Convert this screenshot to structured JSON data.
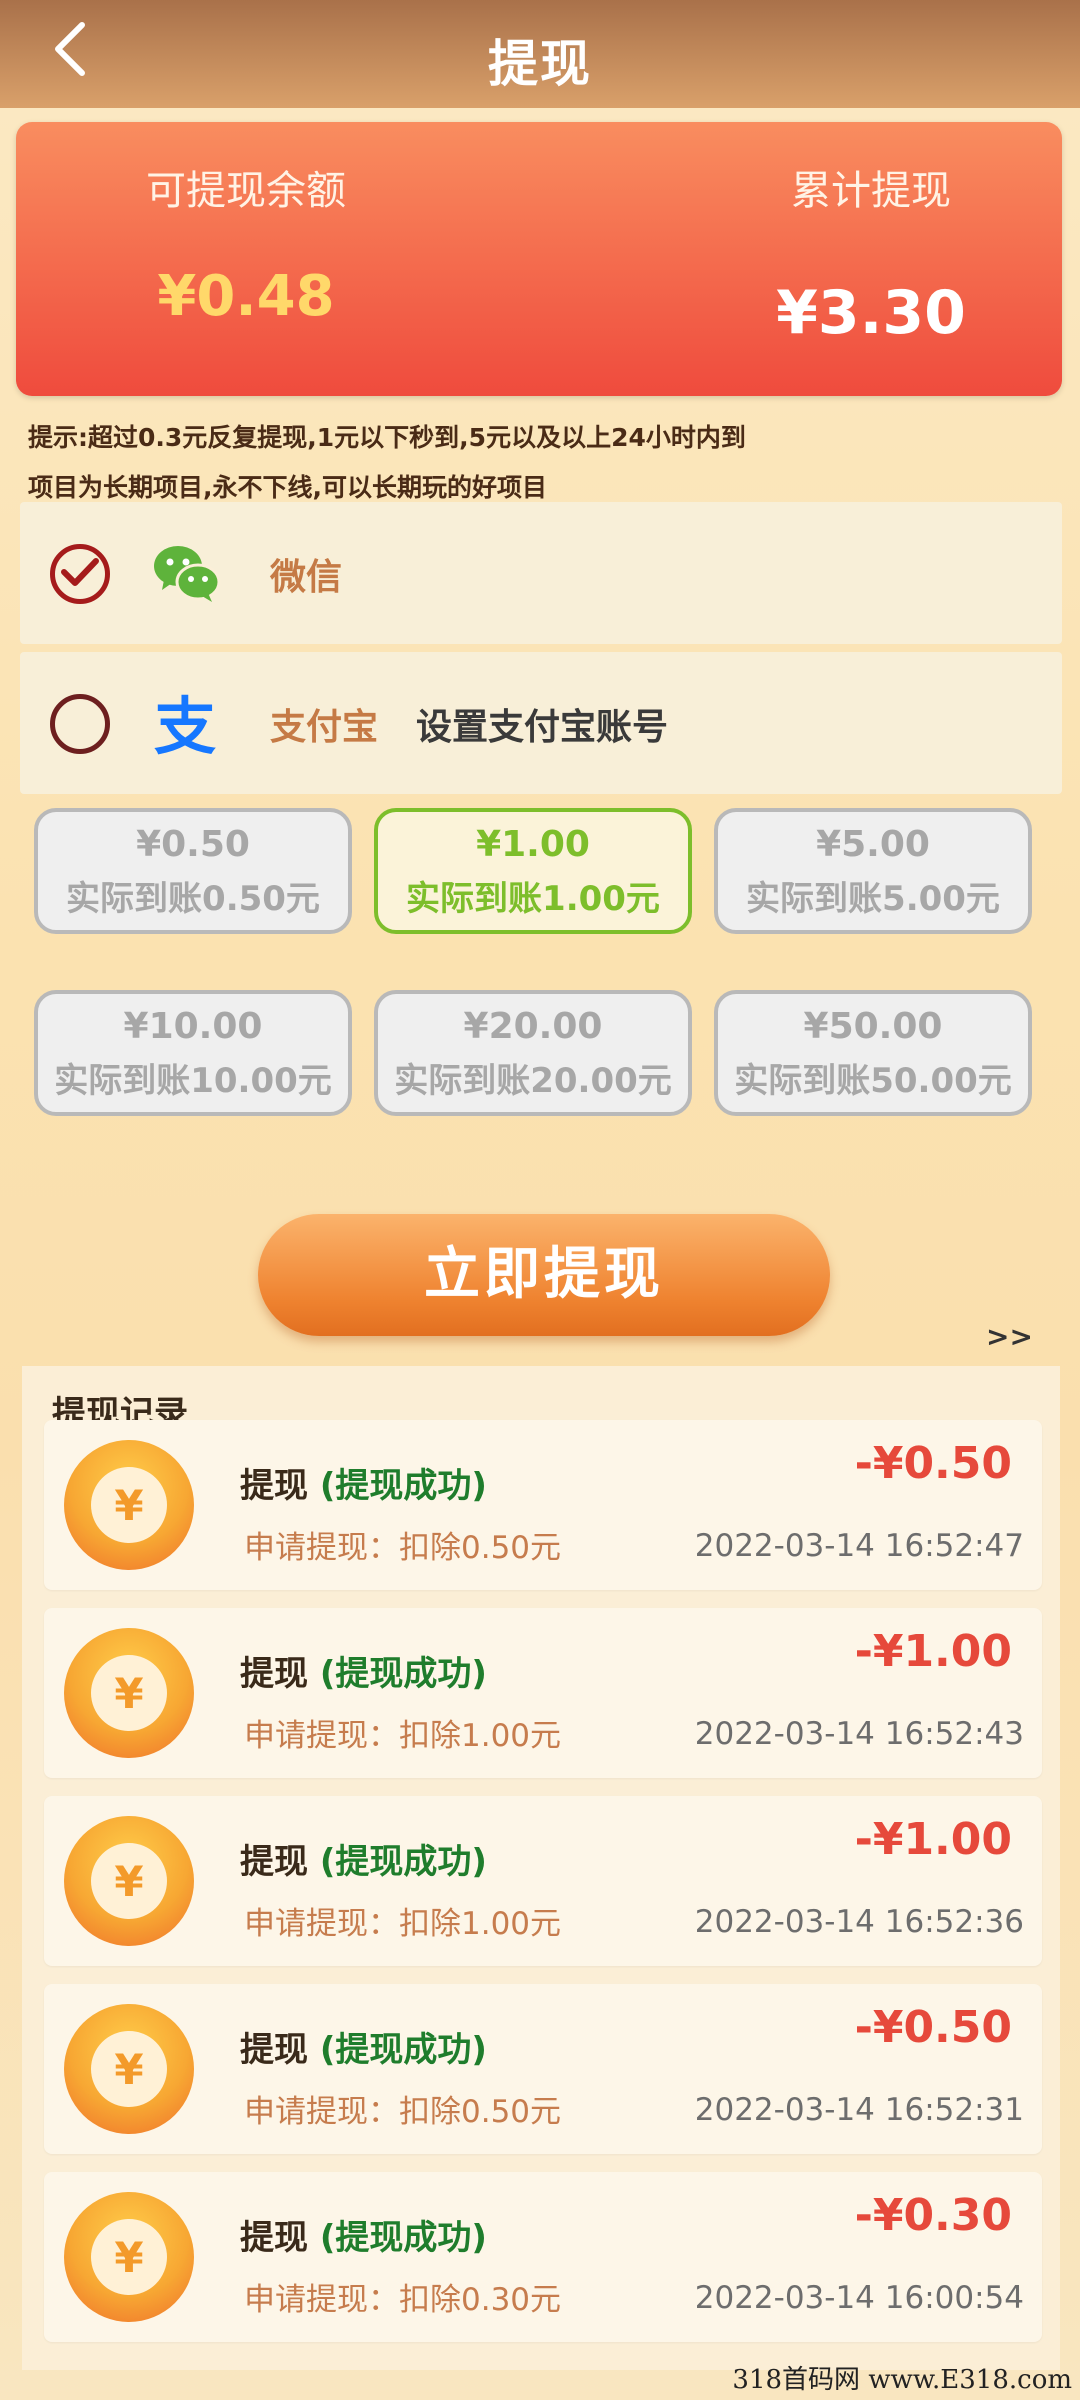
{
  "header": {
    "back_icon": "chevron-left-icon",
    "title": "提现"
  },
  "balance": {
    "available_label": "可提现余额",
    "available_value": "¥0.48",
    "total_label": "累计提现",
    "total_value": "¥3.30"
  },
  "hints": [
    "提示:超过0.3元反复提现,1元以下秒到,5元以及以上24小时内到",
    "项目为长期项目,永不下线,可以长期玩的好项目"
  ],
  "payment_methods": [
    {
      "name": "微信",
      "icon": "wechat-icon",
      "selected": true,
      "extra": ""
    },
    {
      "name": "支付宝",
      "icon": "alipay-icon",
      "selected": false,
      "extra": "设置支付宝账号"
    }
  ],
  "amount_options": [
    {
      "amount": "¥0.50",
      "actual": "实际到账0.50元",
      "selected": false
    },
    {
      "amount": "¥1.00",
      "actual": "实际到账1.00元",
      "selected": true
    },
    {
      "amount": "¥5.00",
      "actual": "实际到账5.00元",
      "selected": false
    },
    {
      "amount": "¥10.00",
      "actual": "实际到账10.00元",
      "selected": false
    },
    {
      "amount": "¥20.00",
      "actual": "实际到账20.00元",
      "selected": false
    },
    {
      "amount": "¥50.00",
      "actual": "实际到账50.00元",
      "selected": false
    }
  ],
  "withdraw_button": "立即提现",
  "more_link": ">>",
  "records": {
    "title": "提现记录",
    "items": [
      {
        "label": "提现",
        "status": "(提现成功)",
        "desc": "申请提现：扣除0.50元",
        "amount": "-¥0.50",
        "time": "2022-03-14  16:52:47"
      },
      {
        "label": "提现",
        "status": "(提现成功)",
        "desc": "申请提现：扣除1.00元",
        "amount": "-¥1.00",
        "time": "2022-03-14  16:52:43"
      },
      {
        "label": "提现",
        "status": "(提现成功)",
        "desc": "申请提现：扣除1.00元",
        "amount": "-¥1.00",
        "time": "2022-03-14  16:52:36"
      },
      {
        "label": "提现",
        "status": "(提现成功)",
        "desc": "申请提现：扣除0.50元",
        "amount": "-¥0.50",
        "time": "2022-03-14  16:52:31"
      },
      {
        "label": "提现",
        "status": "(提现成功)",
        "desc": "申请提现：扣除0.30元",
        "amount": "-¥0.30",
        "time": "2022-03-14  16:00:54"
      }
    ],
    "coin_symbol": "¥"
  },
  "watermark": "318首码网 www.E318.com",
  "colors": {
    "accent": "#ef4b3d",
    "selected_green": "#7dbe2b",
    "status_green": "#1f7d2c"
  }
}
